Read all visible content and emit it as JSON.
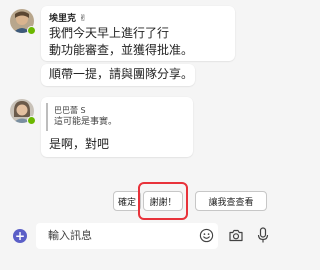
{
  "messages": [
    {
      "sender": "埃里克",
      "sender_emoji": "✌",
      "lines": [
        "我們今天早上進行了行",
        "動功能審查，並獲得批准。"
      ]
    },
    {
      "lines": [
        "順帶一提，請與團隊分享。"
      ]
    },
    {
      "quote_author": "巴巴蕾 S",
      "quote_text": "這可能是事實。",
      "lines": [
        "是啊，對吧"
      ]
    }
  ],
  "suggested_replies": [
    "確定",
    "謝謝！",
    "讓我查查看"
  ],
  "composer": {
    "placeholder": "輸入訊息",
    "add_symbol": "+"
  },
  "colors": {
    "presence": "#6bb700",
    "accent": "#5b5fc7",
    "highlight": "#e8323a"
  },
  "icons": [
    "add-icon",
    "emoji-icon",
    "camera-icon",
    "microphone-icon"
  ]
}
